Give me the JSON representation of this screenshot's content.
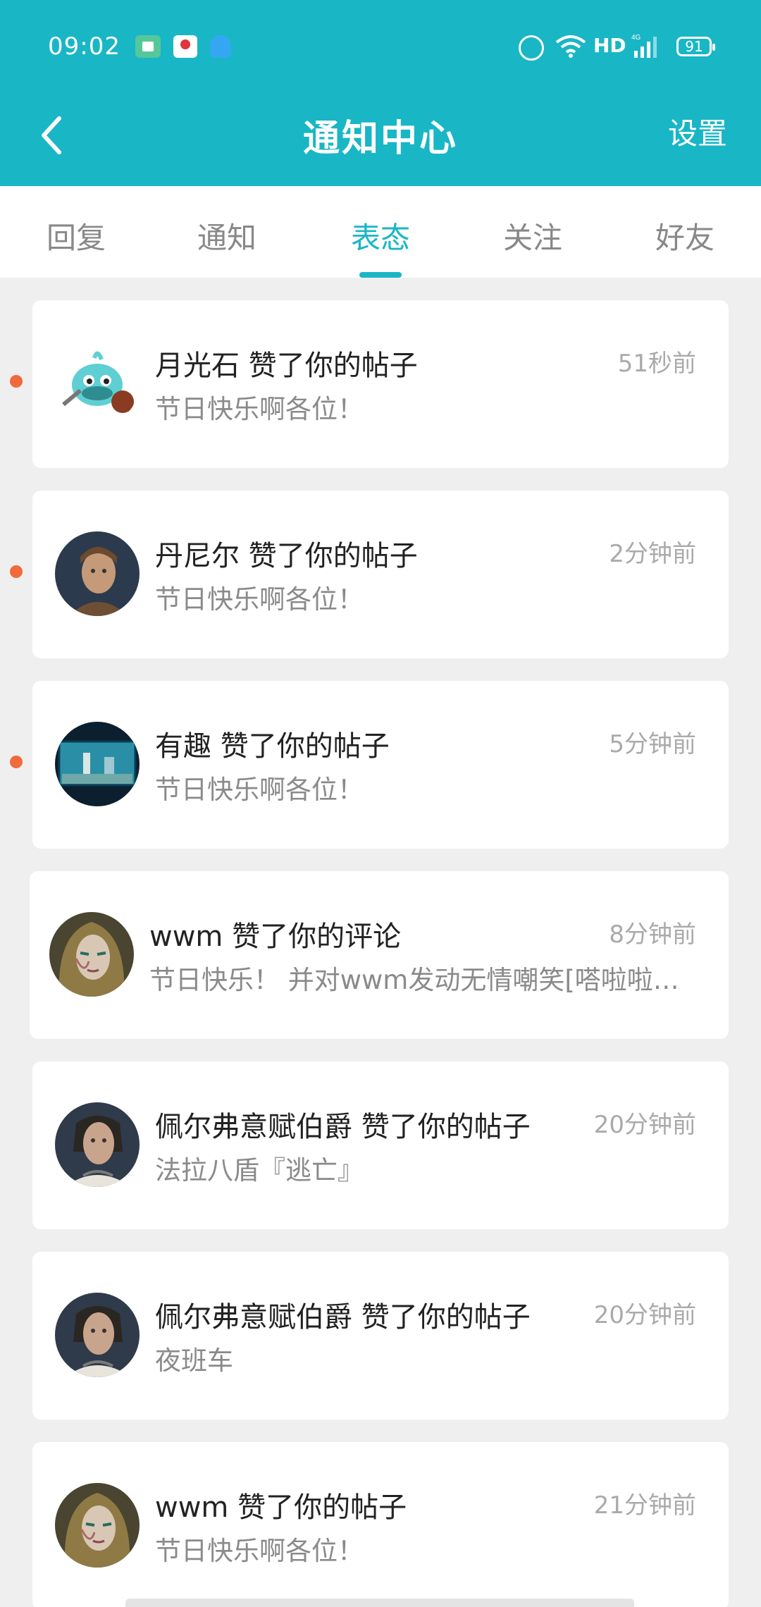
{
  "status_bar": {
    "time": "09:02",
    "network": "HD",
    "battery": "91"
  },
  "nav": {
    "title": "通知中心",
    "settings": "设置"
  },
  "tabs": [
    {
      "label": "回复"
    },
    {
      "label": "通知"
    },
    {
      "label": "表态"
    },
    {
      "label": "关注"
    },
    {
      "label": "好友"
    }
  ],
  "active_tab": "表态",
  "colors": {
    "accent": "#19b6c6",
    "unread_dot": "#f06a3c"
  },
  "notifications": [
    {
      "title": "月光石 赞了你的帖子",
      "subtitle": "节日快乐啊各位！",
      "time": "51秒前",
      "unread": true,
      "avatar": "cartoon-fish-avatar"
    },
    {
      "title": "丹尼尔 赞了你的帖子",
      "subtitle": "节日快乐啊各位！",
      "time": "2分钟前",
      "unread": true,
      "avatar": "warrior-avatar"
    },
    {
      "title": "有趣 赞了你的帖子",
      "subtitle": "节日快乐啊各位！",
      "time": "5分钟前",
      "unread": true,
      "avatar": "aquarium-avatar"
    },
    {
      "title": "wwm 赞了你的评论",
      "subtitle": "节日快乐！ 并对wwm发动无情嘲笑[嗒啦啦…",
      "time": "8分钟前",
      "unread": false,
      "avatar": "painted-face-avatar"
    },
    {
      "title": "佩尔弗意赋伯爵 赞了你的帖子",
      "subtitle": "法拉八盾『逃亡』",
      "time": "20分钟前",
      "unread": false,
      "avatar": "count-avatar"
    },
    {
      "title": "佩尔弗意赋伯爵 赞了你的帖子",
      "subtitle": "夜班车",
      "time": "20分钟前",
      "unread": false,
      "avatar": "count-avatar"
    },
    {
      "title": "wwm 赞了你的帖子",
      "subtitle": "节日快乐啊各位！",
      "time": "21分钟前",
      "unread": false,
      "avatar": "painted-face-avatar"
    }
  ]
}
